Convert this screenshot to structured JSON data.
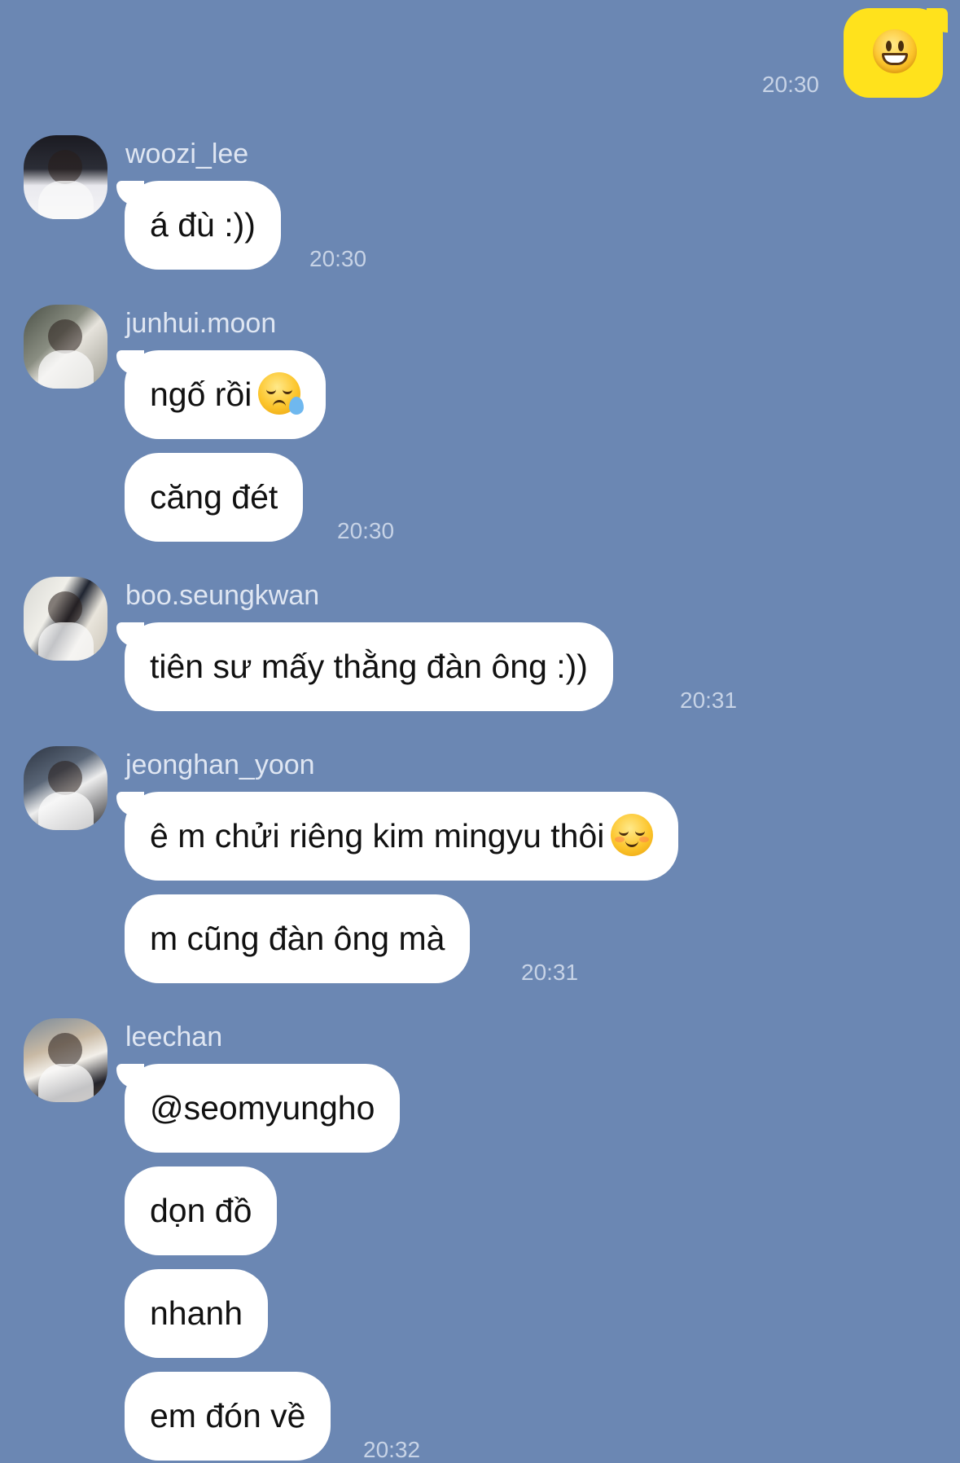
{
  "outgoing": {
    "emoji": "grinning-face",
    "time": "20:30"
  },
  "groups": [
    {
      "sender": "woozi_lee",
      "messages": [
        "á đù :))"
      ],
      "time": "20:30"
    },
    {
      "sender": "junhui.moon",
      "messages": [
        "ngố rồi",
        "căng đét"
      ],
      "time": "20:30",
      "emoji_after_first": "sleepy-face"
    },
    {
      "sender": "boo.seungkwan",
      "messages": [
        "tiên sư mấy thằng đàn ông :))"
      ],
      "time": "20:31"
    },
    {
      "sender": "jeonghan_yoon",
      "messages": [
        "ê m chửi riêng kim mingyu thôi",
        "m cũng đàn ông mà"
      ],
      "time": "20:31",
      "emoji_after_first": "smiling-face"
    },
    {
      "sender": "leechan",
      "messages": [
        "@seomyungho",
        "dọn đồ",
        "nhanh",
        "em đón về"
      ],
      "time": "20:32"
    }
  ],
  "colors": {
    "background": "#6b87b3",
    "incoming_bubble": "#ffffff",
    "outgoing_bubble": "#ffe21c",
    "meta_text": "#c7d3e6"
  }
}
